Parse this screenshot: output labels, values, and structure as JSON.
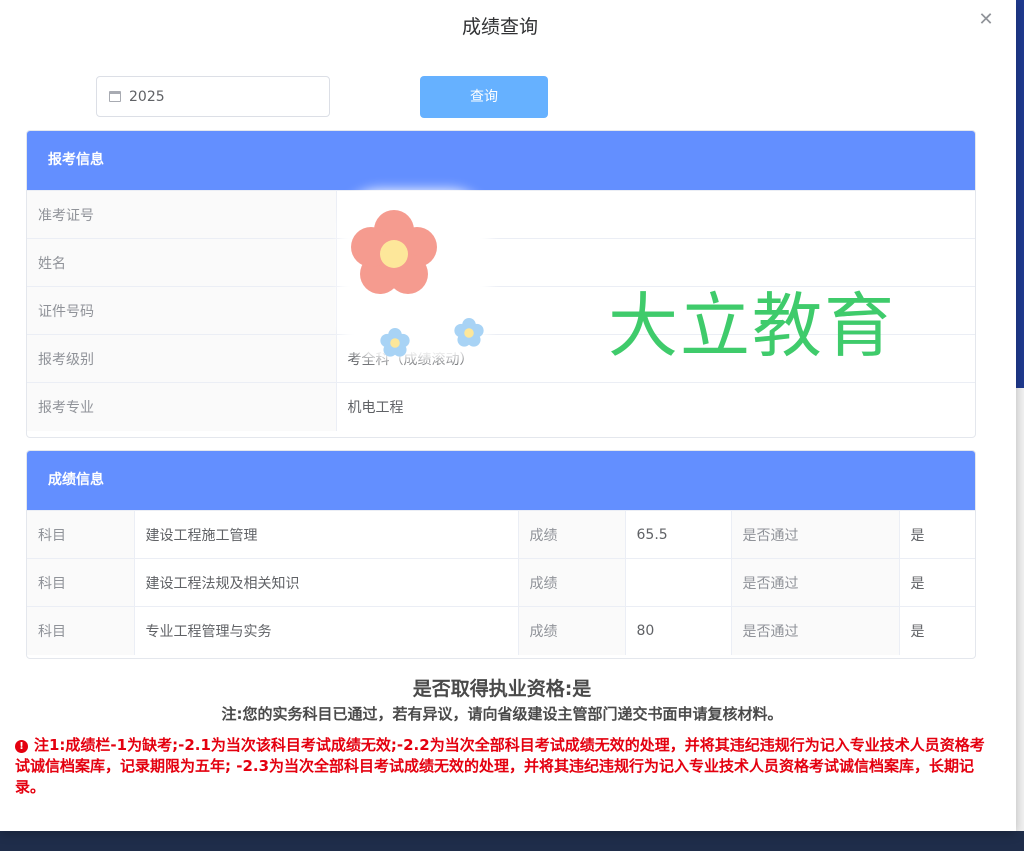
{
  "dialog": {
    "title": "成绩查询",
    "close_icon": "close-icon"
  },
  "search": {
    "year_value": "2025",
    "query_label": "查询"
  },
  "exam_info": {
    "header": "报考信息",
    "rows": [
      {
        "label": "准考证号",
        "value": ""
      },
      {
        "label": "姓名",
        "value": ""
      },
      {
        "label": "证件号码",
        "value": ""
      },
      {
        "label": "报考级别",
        "value": "考全科（成绩滚动）"
      },
      {
        "label": "报考专业",
        "value": "机电工程"
      }
    ]
  },
  "score_info": {
    "header": "成绩信息",
    "rows": [
      {
        "subject_label": "科目",
        "subject": "建设工程施工管理",
        "score_label": "成绩",
        "score": "65.5",
        "pass_label": "是否通过",
        "pass": "是"
      },
      {
        "subject_label": "科目",
        "subject": "建设工程法规及相关知识",
        "score_label": "成绩",
        "score": "",
        "pass_label": "是否通过",
        "pass": "是"
      },
      {
        "subject_label": "科目",
        "subject": "专业工程管理与实务",
        "score_label": "成绩",
        "score": "80",
        "pass_label": "是否通过",
        "pass": "是"
      }
    ]
  },
  "qualification": "是否取得执业资格:是",
  "note": "注:您的实务科目已通过，若有异议，请向省级建设主管部门递交书面申请复核材料。",
  "warning": "注1:成绩栏-1为缺考;-2.1为当次该科目考试成绩无效;-2.2为当次全部科目考试成绩无效的处理，并将其违纪违规行为记入专业技术人员资格考试诚信档案库，记录期限为五年; -2.3为当次全部科目考试成绩无效的处理，并将其违纪违规行为记入专业技术人员资格考试诚信档案库，长期记录。",
  "watermark": "大立教育",
  "colors": {
    "header_blue": "#638fff",
    "button_blue": "#66b1ff",
    "warning_red": "#e4000f",
    "watermark_green": "#3fcb6b"
  }
}
